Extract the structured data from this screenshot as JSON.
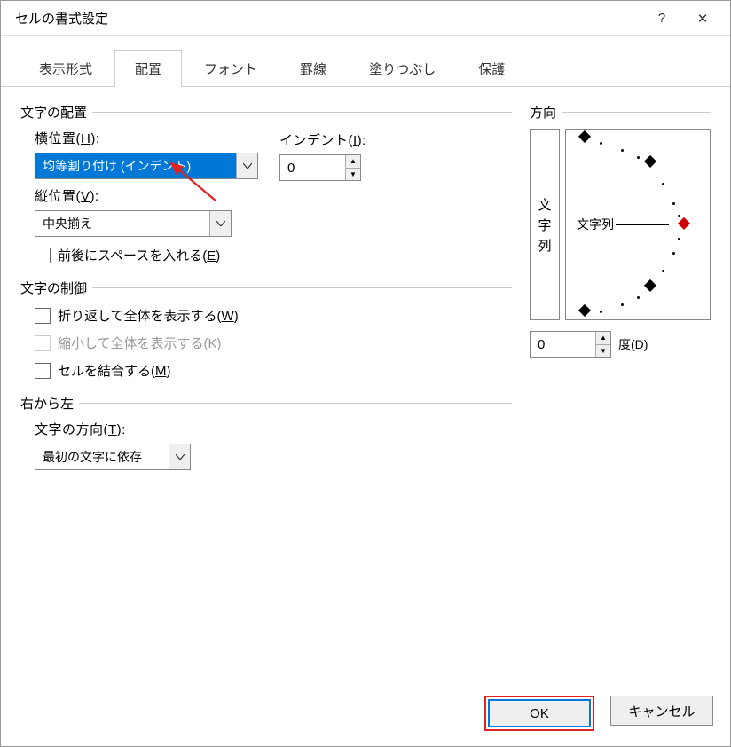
{
  "title": "セルの書式設定",
  "titlebar": {
    "help": "?",
    "close": "✕"
  },
  "tabs": [
    {
      "label": "表示形式",
      "active": false
    },
    {
      "label": "配置",
      "active": true
    },
    {
      "label": "フォント",
      "active": false
    },
    {
      "label": "罫線",
      "active": false
    },
    {
      "label": "塗りつぶし",
      "active": false
    },
    {
      "label": "保護",
      "active": false
    }
  ],
  "align": {
    "section": "文字の配置",
    "horizontal_label_pre": "横位置(",
    "horizontal_key": "H",
    "horizontal_label_post": "):",
    "horizontal_value": "均等割り付け (インデント)",
    "indent_label_pre": "インデント(",
    "indent_key": "I",
    "indent_label_post": "):",
    "indent_value": "0",
    "vertical_label_pre": "縦位置(",
    "vertical_key": "V",
    "vertical_label_post": "):",
    "vertical_value": "中央揃え",
    "space_label_pre": "前後にスペースを入れる(",
    "space_key": "E",
    "space_label_post": ")"
  },
  "control": {
    "section": "文字の制御",
    "wrap_pre": "折り返して全体を表示する(",
    "wrap_key": "W",
    "wrap_post": ")",
    "shrink": "縮小して全体を表示する(K)",
    "merge_pre": "セルを結合する(",
    "merge_key": "M",
    "merge_post": ")"
  },
  "rtl": {
    "section": "右から左",
    "dir_label_pre": "文字の方向(",
    "dir_key": "T",
    "dir_label_post": "):",
    "dir_value": "最初の文字に依存"
  },
  "orient": {
    "section": "方向",
    "vert_chars": [
      "文",
      "字",
      "列"
    ],
    "center_text": "文字列",
    "degree_value": "0",
    "degree_label_pre": "度(",
    "degree_key": "D",
    "degree_label_post": ")"
  },
  "buttons": {
    "ok": "OK",
    "cancel": "キャンセル"
  }
}
